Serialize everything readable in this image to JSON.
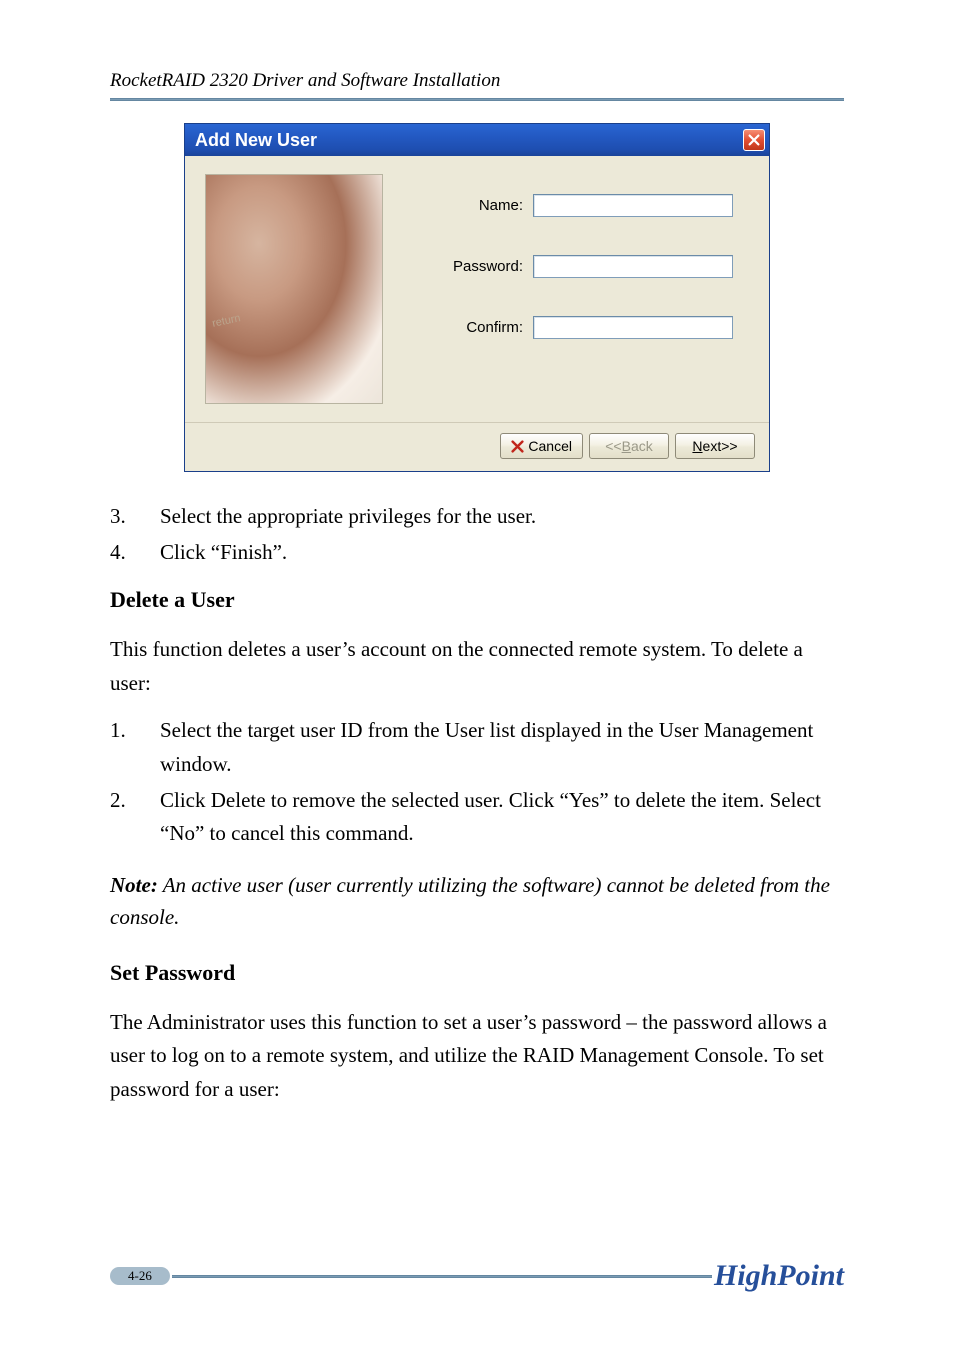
{
  "header": {
    "title": "RocketRAID 2320 Driver and Software Installation"
  },
  "dialog": {
    "title": "Add New User",
    "labels": {
      "name": "Name:",
      "password": "Password:",
      "confirm": "Confirm:"
    },
    "values": {
      "name": "",
      "password": "",
      "confirm": ""
    },
    "footer": {
      "cancel": "Cancel",
      "back_pre": "<<",
      "back_u": "B",
      "back_rest": "ack",
      "next_u": "N",
      "next_rest": "ext>>"
    },
    "side_image_tag": "return"
  },
  "list1": [
    {
      "num": "3.",
      "text": "Select the appropriate privileges for the user."
    },
    {
      "num": "4.",
      "text": "Click “Finish”."
    }
  ],
  "section1": {
    "heading": "Delete a User",
    "intro": "This function deletes a user’s account on the connected remote system.  To delete a user:",
    "items": [
      {
        "num": "1.",
        "text": "Select the target user ID from the User list displayed in the User Management window."
      },
      {
        "num": "2.",
        "text": "Click Delete to remove the selected user. Click “Yes” to delete the item.  Select “No” to cancel this command."
      }
    ]
  },
  "note": {
    "label": "Note:",
    "text": " An active user (user currently utilizing the software) cannot be deleted from the console."
  },
  "section2": {
    "heading": "Set Password",
    "intro": "The Administrator uses this function to set a user’s password – the password allows a user to log on to a remote system, and utilize the RAID Management Console.  To set password for a user:"
  },
  "footer": {
    "page": "4-26",
    "brand": "HighPoint"
  }
}
